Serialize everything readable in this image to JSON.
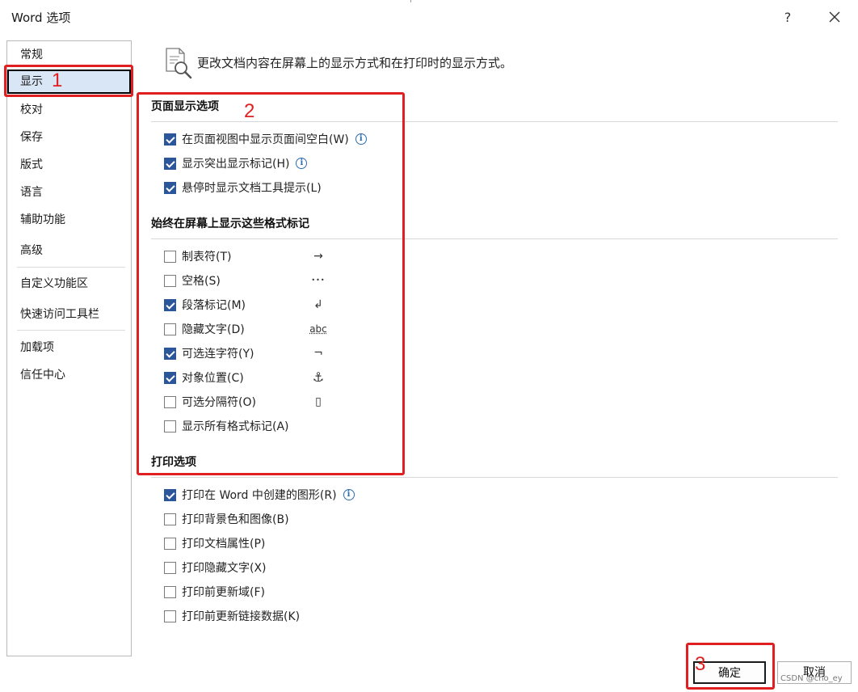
{
  "window": {
    "title": "Word 选项",
    "help": "?",
    "close_icon": "close-icon"
  },
  "sidebar": {
    "items": [
      {
        "label": "常规"
      },
      {
        "label": "显示"
      },
      {
        "label": "校对"
      },
      {
        "label": "保存"
      },
      {
        "label": "版式"
      },
      {
        "label": "语言"
      },
      {
        "label": "辅助功能"
      },
      {
        "label": "高级"
      },
      {
        "label": "自定义功能区"
      },
      {
        "label": "快速访问工具栏"
      },
      {
        "label": "加载项"
      },
      {
        "label": "信任中心"
      }
    ],
    "selected": "显示"
  },
  "header": {
    "icon": "document-magnifier-icon",
    "text": "更改文档内容在屏幕上的显示方式和在打印时的显示方式。"
  },
  "sections": {
    "page_display": {
      "title": "页面显示选项",
      "options": [
        {
          "label": "在页面视图中显示页面间空白(W)",
          "checked": true,
          "info": true
        },
        {
          "label": "显示突出显示标记(H)",
          "checked": true,
          "info": true
        },
        {
          "label": "悬停时显示文档工具提示(L)",
          "checked": true,
          "info": false
        }
      ]
    },
    "format_marks": {
      "title": "始终在屏幕上显示这些格式标记",
      "options": [
        {
          "label": "制表符(T)",
          "checked": false,
          "symbol": "→"
        },
        {
          "label": "空格(S)",
          "checked": false,
          "symbol": "•••"
        },
        {
          "label": "段落标记(M)",
          "checked": true,
          "symbol": "↲"
        },
        {
          "label": "隐藏文字(D)",
          "checked": false,
          "symbol": "abc"
        },
        {
          "label": "可选连字符(Y)",
          "checked": true,
          "symbol": "¬"
        },
        {
          "label": "对象位置(C)",
          "checked": true,
          "symbol": "⚓"
        },
        {
          "label": "可选分隔符(O)",
          "checked": false,
          "symbol": "▯"
        },
        {
          "label": "显示所有格式标记(A)",
          "checked": false,
          "symbol": ""
        }
      ]
    },
    "print": {
      "title": "打印选项",
      "options": [
        {
          "label": "打印在 Word 中创建的图形(R)",
          "checked": true,
          "info": true
        },
        {
          "label": "打印背景色和图像(B)",
          "checked": false,
          "info": false
        },
        {
          "label": "打印文档属性(P)",
          "checked": false,
          "info": false
        },
        {
          "label": "打印隐藏文字(X)",
          "checked": false,
          "info": false
        },
        {
          "label": "打印前更新域(F)",
          "checked": false,
          "info": false
        },
        {
          "label": "打印前更新链接数据(K)",
          "checked": false,
          "info": false
        }
      ]
    }
  },
  "buttons": {
    "ok": "确定",
    "cancel": "取消"
  },
  "annotations": {
    "n1": "1",
    "n2": "2",
    "n3": "3",
    "color": "#e02020"
  },
  "watermark": "CSDN @cho_ey",
  "colors": {
    "accent": "#2b579a",
    "selected_bg": "#d9e6f6",
    "info": "#2b6cb0"
  }
}
